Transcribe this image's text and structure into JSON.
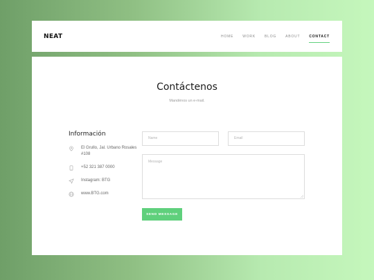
{
  "brand": "NEAT",
  "nav": {
    "items": [
      "HOME",
      "WORK",
      "BLOG",
      "ABOUT",
      "CONTACT"
    ],
    "active": "CONTACT"
  },
  "contact": {
    "title": "Contáctenos",
    "subtitle": "Mandénos un e-mail.",
    "info_title": "Información",
    "address": "El Grullo, Jal. Urbano Rosales #108",
    "phone": "+52 321 387 0000",
    "instagram": "Instagram: BTG",
    "website": "www.BTG.com"
  },
  "form": {
    "name_placeholder": "Name",
    "email_placeholder": "Email",
    "message_placeholder": "Message",
    "send_label": "SEND MESSAGE"
  },
  "colors": {
    "accent": "#5fd07c",
    "bg_left": "#6f9f68",
    "bg_right": "#c5f7bc"
  }
}
